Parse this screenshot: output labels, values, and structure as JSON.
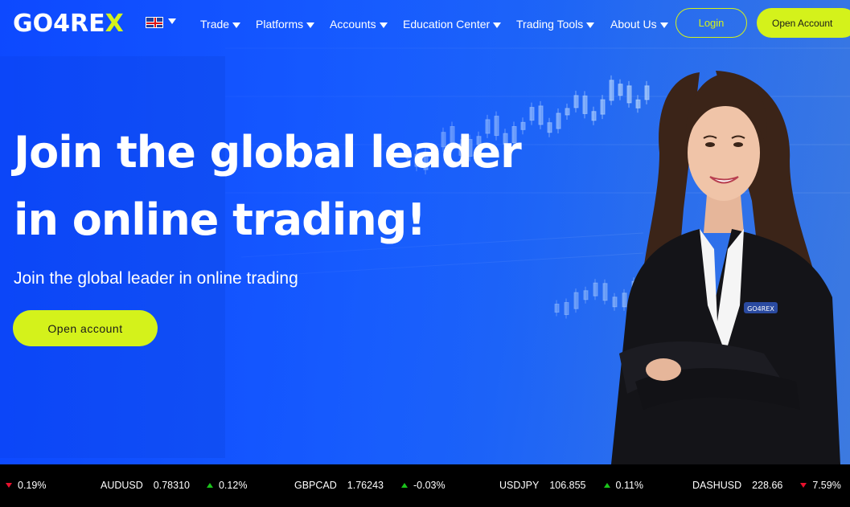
{
  "brand": {
    "logo_text": "GO4RE",
    "logo_x": "X",
    "accent": "#d4f21b",
    "primary": "#1652ff"
  },
  "header": {
    "language_flag": "uk-flag-icon",
    "nav": [
      {
        "label": "Trade"
      },
      {
        "label": "Platforms"
      },
      {
        "label": "Accounts"
      },
      {
        "label": "Education Center"
      },
      {
        "label": "Trading Tools"
      },
      {
        "label": "About Us"
      }
    ],
    "login_label": "Login",
    "open_account_label": "Open Account"
  },
  "hero": {
    "headline_line1": "Join the global leader",
    "headline_line2": "in online trading!",
    "subheadline": "Join the global leader in online trading",
    "cta_label": "Open account",
    "badge_text": "GO4REX"
  },
  "ticker": [
    {
      "symbol": "",
      "price": "",
      "change": "0.19%",
      "direction": "down"
    },
    {
      "symbol": "AUDUSD",
      "price": "0.78310",
      "change": "0.12%",
      "direction": "up"
    },
    {
      "symbol": "GBPCAD",
      "price": "1.76243",
      "change": "-0.03%",
      "direction": "up"
    },
    {
      "symbol": "USDJPY",
      "price": "106.855",
      "change": "0.11%",
      "direction": "up"
    },
    {
      "symbol": "DASHUSD",
      "price": "228.66",
      "change": "7.59%",
      "direction": "down"
    }
  ]
}
